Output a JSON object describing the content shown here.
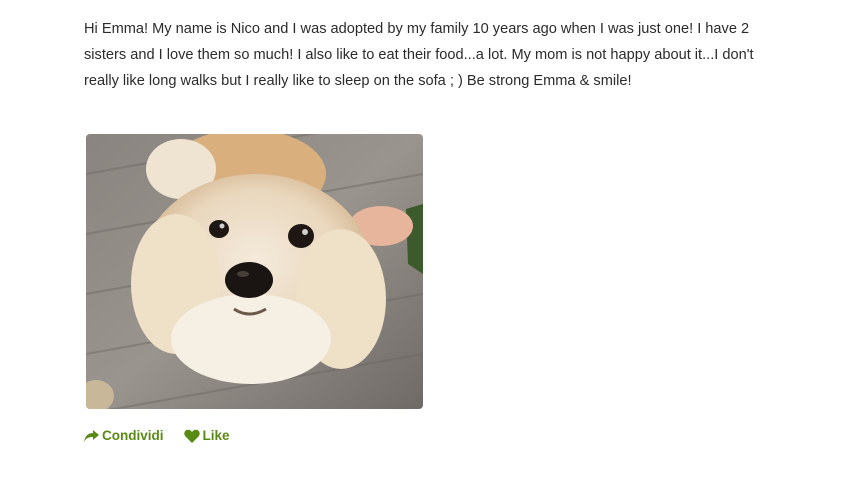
{
  "post": {
    "text": "Hi Emma! My name is Nico and I was adopted by my family 10 years ago when I was just one! I have 2 sisters and I love them so much! I also like to eat their food...a lot. My mom is not happy about it...I don't really like long walks but I really like to sleep on the sofa ; ) Be strong Emma & smile!"
  },
  "actions": {
    "share_label": "Condividi",
    "like_label": "Like"
  },
  "colors": {
    "accent": "#5a8a16",
    "text": "#2b2b2b"
  },
  "icons": {
    "share": "share-arrow-icon",
    "like": "heart-icon"
  }
}
